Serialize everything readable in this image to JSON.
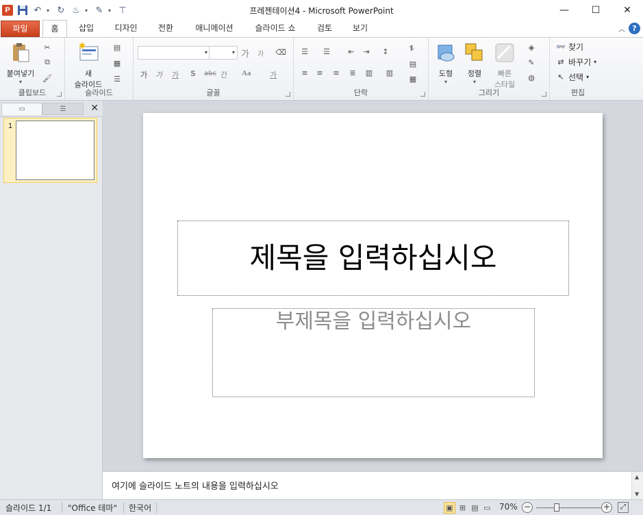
{
  "window": {
    "title": "프레젠테이션4 - Microsoft PowerPoint",
    "app_logo": "P"
  },
  "quick_access": {
    "icons": [
      "save-icon",
      "undo-icon",
      "redo-icon",
      "format-painter-icon",
      "pen-icon",
      "customize-icon"
    ]
  },
  "tabs": [
    {
      "label": "파일"
    },
    {
      "label": "홈"
    },
    {
      "label": "삽입"
    },
    {
      "label": "디자인"
    },
    {
      "label": "전환"
    },
    {
      "label": "애니메이션"
    },
    {
      "label": "슬라이드 쇼"
    },
    {
      "label": "검토"
    },
    {
      "label": "보기"
    }
  ],
  "ribbon": {
    "clipboard": {
      "label": "클립보드",
      "paste": "붙여넣기"
    },
    "slides": {
      "label": "슬라이드",
      "new_slide_line1": "새",
      "new_slide_line2": "슬라이드"
    },
    "font": {
      "label": "글꼴",
      "font_name": "",
      "font_size": "",
      "grow": "가",
      "shrink": "가",
      "bold": "가",
      "italic": "가",
      "underline": "가",
      "shadow": "S",
      "strike": "abc",
      "spacing": "간",
      "case": "Aa",
      "color": "가"
    },
    "paragraph": {
      "label": "단락"
    },
    "drawing": {
      "label": "그리기",
      "shapes": "도형",
      "arrange": "정렬",
      "quick_styles_line1": "빠른",
      "quick_styles_line2": "스타일"
    },
    "editing": {
      "label": "편집",
      "find": "찾기",
      "replace": "바꾸기",
      "select": "선택"
    }
  },
  "slide_pane": {
    "slide_number": "1"
  },
  "slide": {
    "title_placeholder": "제목을 입력하십시오",
    "subtitle_placeholder": "부제목을 입력하십시오"
  },
  "notes": {
    "placeholder": "여기에 슬라이드 노트의 내용을 입력하십시오"
  },
  "status": {
    "slide_info": "슬라이드 1/1",
    "theme": "\"Office 테마\"",
    "language": "한국어",
    "zoom": "70%"
  },
  "colors": {
    "file_tab": "#d24726",
    "accent": "#2d6fc1",
    "selection": "#fde39a"
  }
}
